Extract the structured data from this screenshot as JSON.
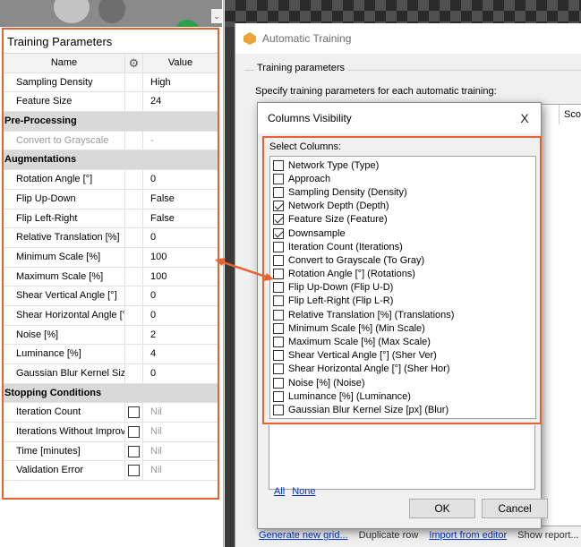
{
  "left_panel": {
    "title": "Training Parameters",
    "columns": {
      "name": "Name",
      "settings_icon": "gear-icon",
      "value": "Value"
    },
    "scroll_icon": "chevron-down-icon",
    "rows": [
      {
        "type": "param",
        "name": "Sampling Density",
        "value": "High"
      },
      {
        "type": "param",
        "name": "Feature Size",
        "value": "24"
      },
      {
        "type": "section",
        "name": "Pre-Processing"
      },
      {
        "type": "param",
        "name": "Convert to Grayscale",
        "value": "-",
        "disabled": true
      },
      {
        "type": "section",
        "name": "Augmentations"
      },
      {
        "type": "param",
        "name": "Rotation Angle [°]",
        "value": "0"
      },
      {
        "type": "param",
        "name": "Flip Up-Down",
        "value": "False"
      },
      {
        "type": "param",
        "name": "Flip Left-Right",
        "value": "False"
      },
      {
        "type": "param",
        "name": "Relative Translation [%]",
        "value": "0"
      },
      {
        "type": "param",
        "name": "Minimum Scale [%]",
        "value": "100"
      },
      {
        "type": "param",
        "name": "Maximum Scale [%]",
        "value": "100"
      },
      {
        "type": "param",
        "name": "Shear Vertical Angle [°]",
        "value": "0"
      },
      {
        "type": "param",
        "name": "Shear Horizontal Angle [°]",
        "value": "0"
      },
      {
        "type": "param",
        "name": "Noise [%]",
        "value": "2"
      },
      {
        "type": "param",
        "name": "Luminance [%]",
        "value": "4"
      },
      {
        "type": "param",
        "name": "Gaussian Blur Kernel Size [...",
        "value": "0"
      },
      {
        "type": "section",
        "name": "Stopping Conditions"
      },
      {
        "type": "param",
        "name": "Iteration Count",
        "value": "Nil",
        "checkbox": true,
        "muted": true
      },
      {
        "type": "param",
        "name": "Iterations Without Improve...",
        "value": "Nil",
        "checkbox": true,
        "muted": true
      },
      {
        "type": "param",
        "name": "Time [minutes]",
        "value": "Nil",
        "checkbox": true,
        "muted": true
      },
      {
        "type": "param",
        "name": "Validation Error",
        "value": "Nil",
        "checkbox": true,
        "muted": true
      }
    ]
  },
  "auto_window": {
    "title": "Automatic Training",
    "icon": "package-icon",
    "group_label": "Training parameters",
    "description": "Specify training parameters for each automatic training:",
    "grid_header_partial": "Score (Te",
    "bottom_links": {
      "generate": "Generate new grid...",
      "duplicate": "Duplicate row",
      "import": "Import from editor",
      "show_report": "Show report..."
    }
  },
  "dialog": {
    "title": "Columns Visibility",
    "close_glyph": "X",
    "select_label": "Select Columns:",
    "items": [
      {
        "label": "Network Type (Type)",
        "checked": false
      },
      {
        "label": "Approach",
        "checked": false
      },
      {
        "label": "Sampling Density (Density)",
        "checked": false
      },
      {
        "label": "Network Depth (Depth)",
        "checked": true
      },
      {
        "label": "Feature Size (Feature)",
        "checked": true
      },
      {
        "label": "Downsample",
        "checked": true
      },
      {
        "label": "Iteration Count (Iterations)",
        "checked": false
      },
      {
        "label": "Convert to Grayscale (To Gray)",
        "checked": false
      },
      {
        "label": "Rotation Angle [°] (Rotations)",
        "checked": false
      },
      {
        "label": "Flip Up-Down (Flip U-D)",
        "checked": false
      },
      {
        "label": "Flip Left-Right (Flip L-R)",
        "checked": false
      },
      {
        "label": "Relative Translation [%] (Translations)",
        "checked": false
      },
      {
        "label": "Minimum Scale [%] (Min Scale)",
        "checked": false
      },
      {
        "label": "Maximum Scale [%] (Max Scale)",
        "checked": false
      },
      {
        "label": "Shear Vertical Angle [°] (Sher Ver)",
        "checked": false
      },
      {
        "label": "Shear Horizontal Angle [°] (Sher Hor)",
        "checked": false
      },
      {
        "label": "Noise [%] (Noise)",
        "checked": false
      },
      {
        "label": "Luminance [%] (Luminance)",
        "checked": false
      },
      {
        "label": "Gaussian Blur Kernel Size [px] (Blur)",
        "checked": false
      }
    ],
    "link_all": "All",
    "link_none": "None",
    "ok_label": "OK",
    "cancel_label": "Cancel"
  },
  "colors": {
    "highlight": "#e8622f",
    "link": "#0033cc",
    "section_bg": "#d9d9d9"
  }
}
